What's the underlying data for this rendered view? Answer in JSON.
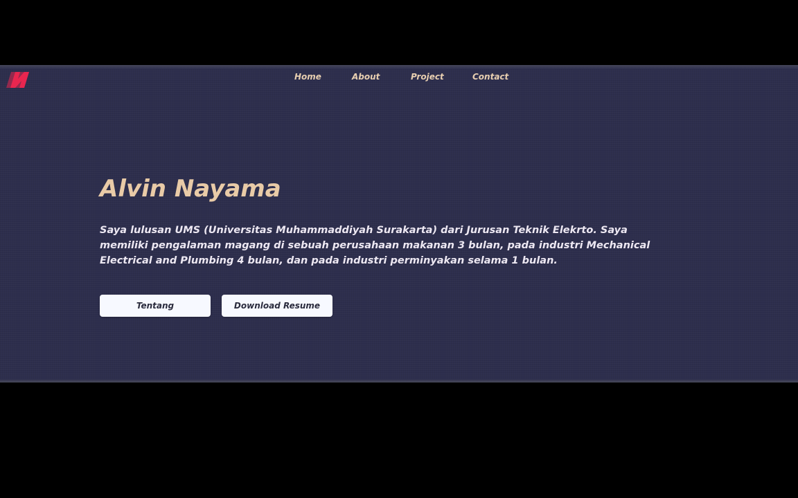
{
  "brand": {
    "logo_letter": "N",
    "logo_color": "#e8264f"
  },
  "nav": {
    "items": [
      {
        "label": "Home"
      },
      {
        "label": "About"
      },
      {
        "label": "Project"
      },
      {
        "label": "Contact"
      }
    ]
  },
  "hero": {
    "name": "Alvin Nayama",
    "description": "Saya lulusan UMS (Universitas Muhammaddiyah Surakarta) dari Jurusan Teknik Elekrto. Saya memiliki pengalaman magang di sebuah perusahaan makanan 3 bulan, pada industri Mechanical Electrical and Plumbing 4 bulan, dan pada industri perminyakan selama 1 bulan.",
    "buttons": {
      "primary_label": "Tentang",
      "secondary_label": "Download Resume"
    }
  },
  "colors": {
    "background": "#2d2e4d",
    "accent": "#e9cba7",
    "text": "#ede8f2",
    "button_bg": "#f7f9ff"
  }
}
